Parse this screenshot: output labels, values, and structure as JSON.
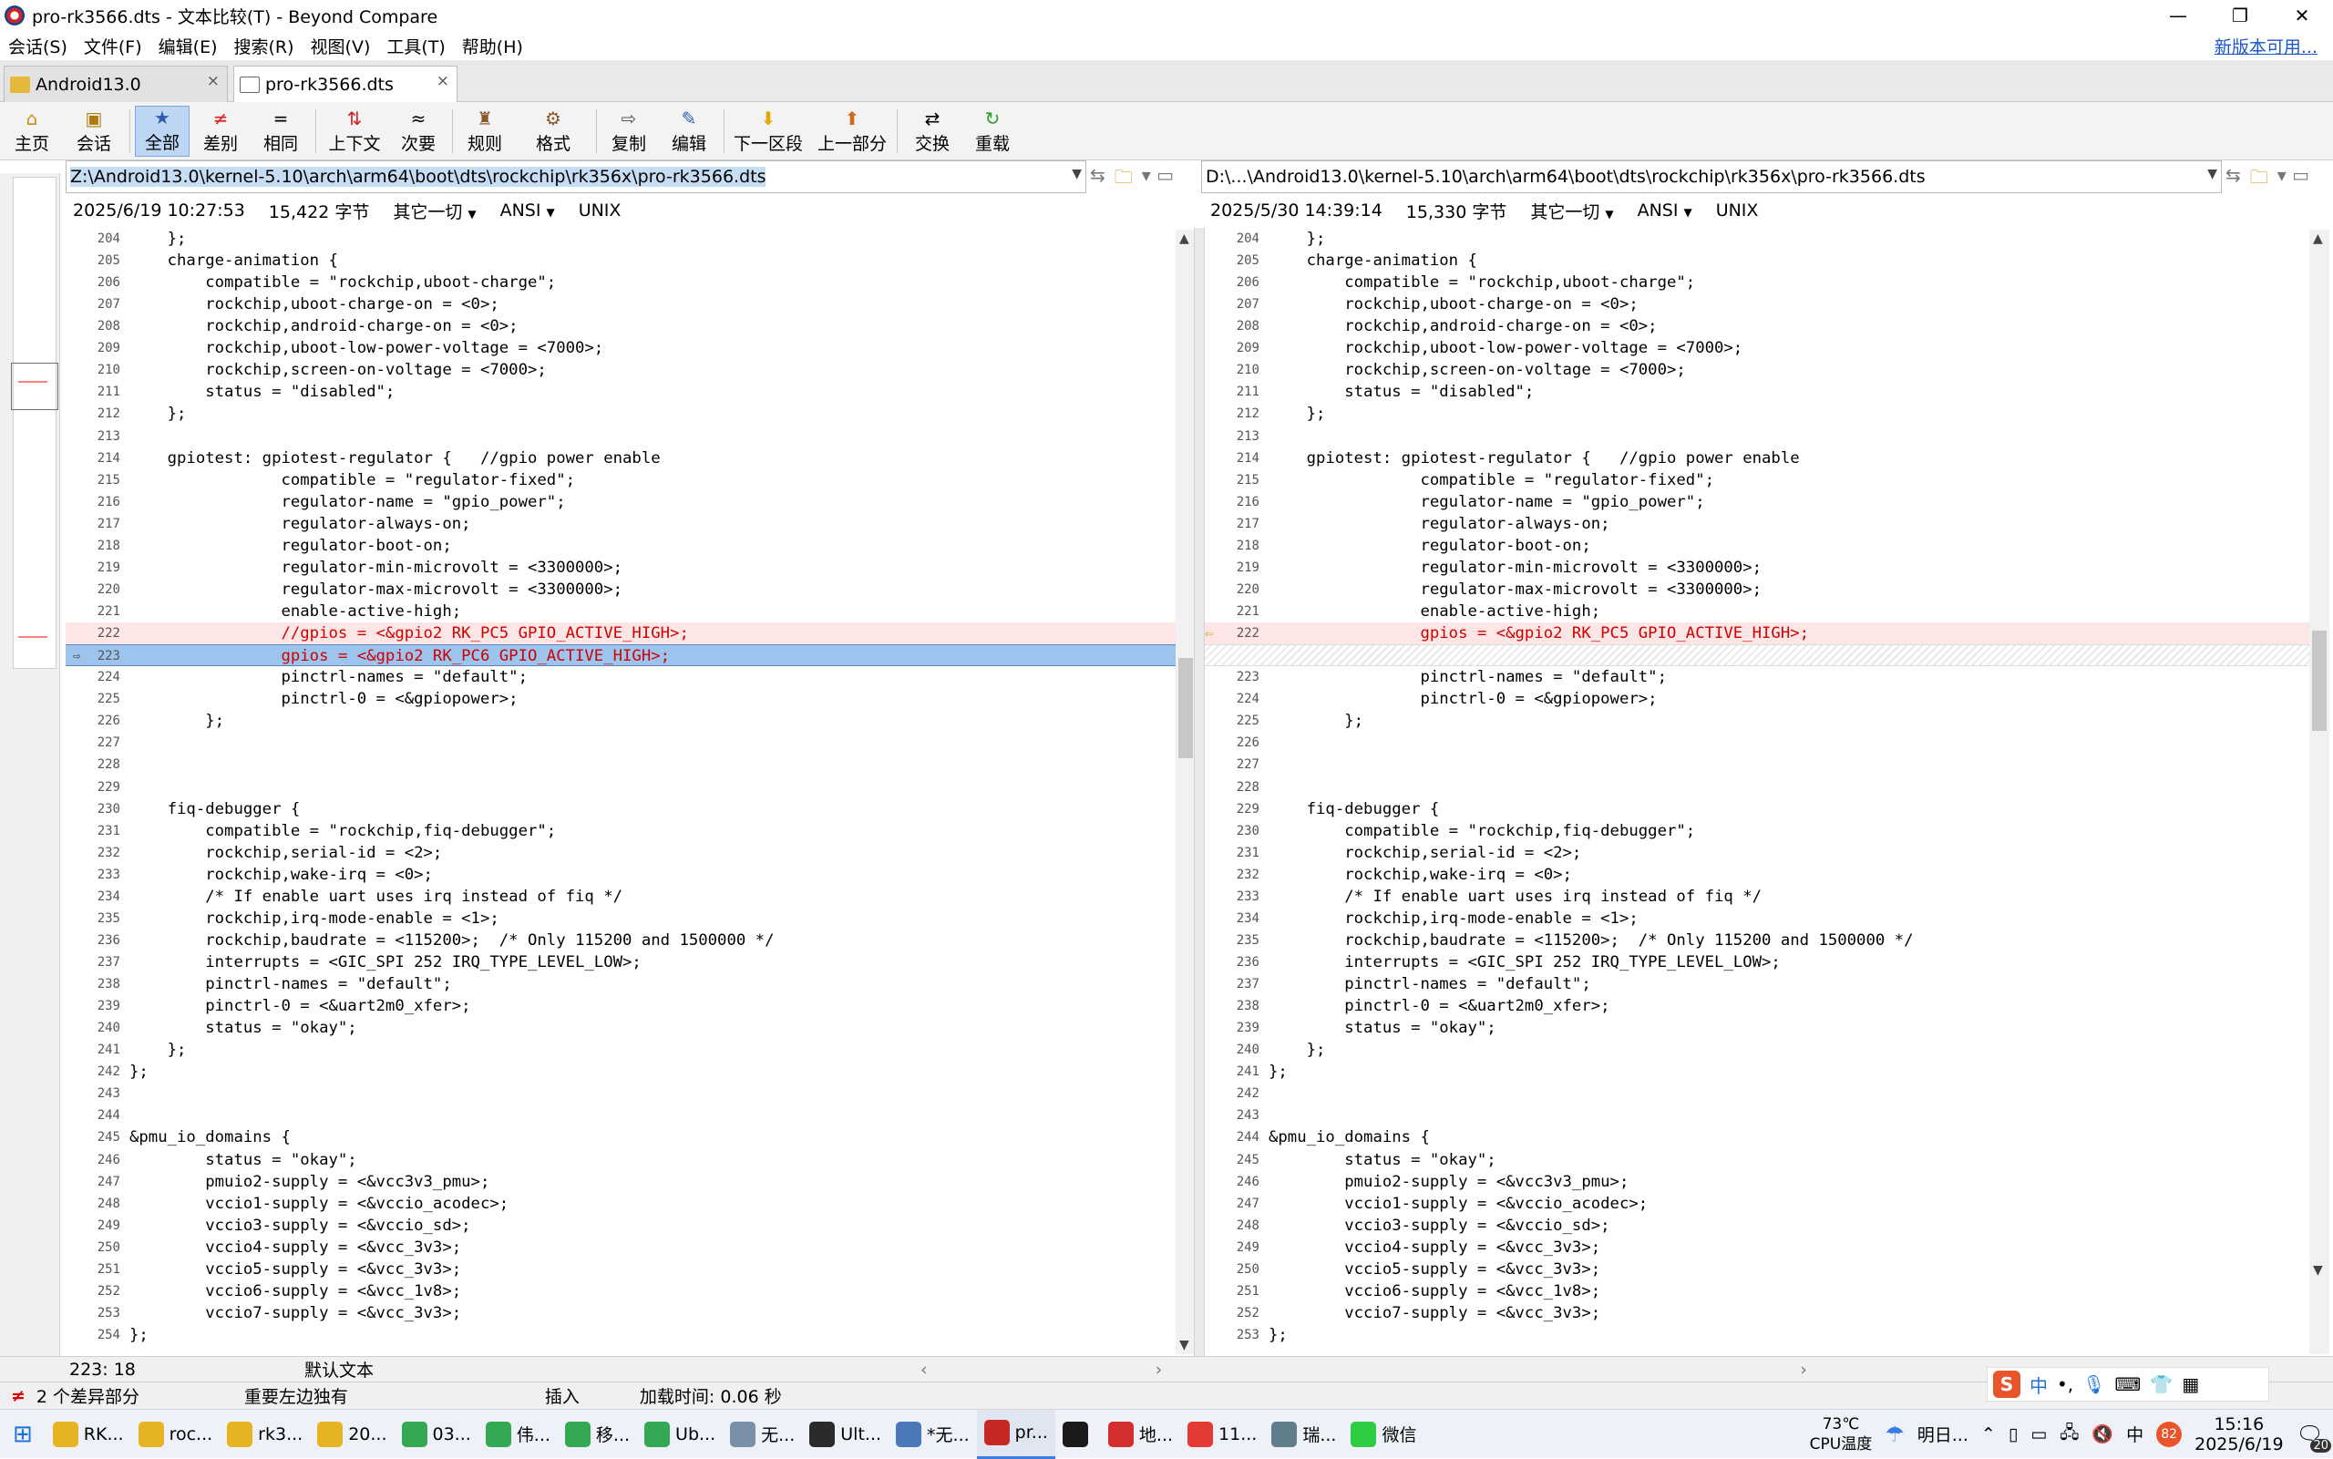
{
  "window": {
    "title": "pro-rk3566.dts - 文本比较(T) - Beyond Compare",
    "minimize": "—",
    "maximize": "❐",
    "close": "✕"
  },
  "menu": {
    "items": [
      "会话(S)",
      "文件(F)",
      "编辑(E)",
      "搜索(R)",
      "视图(V)",
      "工具(T)",
      "帮助(H)"
    ],
    "update_link": "新版本可用..."
  },
  "tabs": [
    {
      "label": "Android13.0",
      "close": "×"
    },
    {
      "label": "pro-rk3566.dts",
      "close": "×"
    }
  ],
  "toolbar": {
    "buttons": [
      {
        "label": "主页",
        "icon": "home-icon",
        "glyph": "⌂"
      },
      {
        "label": "会话",
        "icon": "session-icon",
        "glyph": "▣"
      },
      {
        "label": "全部",
        "icon": "all-icon",
        "glyph": "★"
      },
      {
        "label": "差别",
        "icon": "diffs-icon",
        "glyph": "≠"
      },
      {
        "label": "相同",
        "icon": "same-icon",
        "glyph": "="
      },
      {
        "label": "上下文",
        "icon": "context-icon",
        "glyph": "⇅"
      },
      {
        "label": "次要",
        "icon": "minor-icon",
        "glyph": "≈"
      },
      {
        "label": "规则",
        "icon": "rules-icon",
        "glyph": "♜"
      },
      {
        "label": "格式",
        "icon": "format-icon",
        "glyph": "⚙"
      },
      {
        "label": "复制",
        "icon": "copy-icon",
        "glyph": "⇨"
      },
      {
        "label": "编辑",
        "icon": "edit-icon",
        "glyph": "✎"
      },
      {
        "label": "下一区段",
        "icon": "next-section-icon",
        "glyph": "⬇"
      },
      {
        "label": "上一部分",
        "icon": "prev-section-icon",
        "glyph": "⬆"
      },
      {
        "label": "交换",
        "icon": "swap-icon",
        "glyph": "⇄"
      },
      {
        "label": "重载",
        "icon": "reload-icon",
        "glyph": "↻"
      }
    ]
  },
  "left": {
    "path": "Z:\\Android13.0\\kernel-5.10\\arch\\arm64\\boot\\dts\\rockchip\\rk356x\\pro-rk3566.dts",
    "date": "2025/6/19 10:27:53",
    "size": "15,422 字节",
    "filter": "其它一切",
    "encoding": "ANSI",
    "eol": "UNIX"
  },
  "right": {
    "path": "D:\\...\\Android13.0\\kernel-5.10\\arch\\arm64\\boot\\dts\\rockchip\\rk356x\\pro-rk3566.dts",
    "date": "2025/5/30 14:39:14",
    "size": "15,330 字节",
    "filter": "其它一切",
    "encoding": "ANSI",
    "eol": "UNIX"
  },
  "left_lines": [
    {
      "n": "204",
      "t": "    };"
    },
    {
      "n": "205",
      "t": "    charge-animation {"
    },
    {
      "n": "206",
      "t": "        compatible = \"rockchip,uboot-charge\";"
    },
    {
      "n": "207",
      "t": "        rockchip,uboot-charge-on = <0>;"
    },
    {
      "n": "208",
      "t": "        rockchip,android-charge-on = <0>;"
    },
    {
      "n": "209",
      "t": "        rockchip,uboot-low-power-voltage = <7000>;"
    },
    {
      "n": "210",
      "t": "        rockchip,screen-on-voltage = <7000>;"
    },
    {
      "n": "211",
      "t": "        status = \"disabled\";"
    },
    {
      "n": "212",
      "t": "    };"
    },
    {
      "n": "213",
      "t": ""
    },
    {
      "n": "214",
      "t": "    gpiotest: gpiotest-regulator {   //gpio power enable"
    },
    {
      "n": "215",
      "t": "                compatible = \"regulator-fixed\";"
    },
    {
      "n": "216",
      "t": "                regulator-name = \"gpio_power\";"
    },
    {
      "n": "217",
      "t": "                regulator-always-on;"
    },
    {
      "n": "218",
      "t": "                regulator-boot-on;"
    },
    {
      "n": "219",
      "t": "                regulator-min-microvolt = <3300000>;"
    },
    {
      "n": "220",
      "t": "                regulator-max-microvolt = <3300000>;"
    },
    {
      "n": "221",
      "t": "                enable-active-high;"
    },
    {
      "n": "222",
      "t": "                //gpios = <&gpio2 RK_PC5 GPIO_ACTIVE_HIGH>;",
      "k": "diff"
    },
    {
      "n": "223",
      "t": "                gpios = <&gpio2 RK_PC6 GPIO_ACTIVE_HIGH>;",
      "k": "cur"
    },
    {
      "n": "224",
      "t": "                pinctrl-names = \"default\";"
    },
    {
      "n": "225",
      "t": "                pinctrl-0 = <&gpiopower>;"
    },
    {
      "n": "226",
      "t": "        };"
    },
    {
      "n": "227",
      "t": ""
    },
    {
      "n": "228",
      "t": ""
    },
    {
      "n": "229",
      "t": ""
    },
    {
      "n": "230",
      "t": "    fiq-debugger {"
    },
    {
      "n": "231",
      "t": "        compatible = \"rockchip,fiq-debugger\";"
    },
    {
      "n": "232",
      "t": "        rockchip,serial-id = <2>;"
    },
    {
      "n": "233",
      "t": "        rockchip,wake-irq = <0>;"
    },
    {
      "n": "234",
      "t": "        /* If enable uart uses irq instead of fiq */"
    },
    {
      "n": "235",
      "t": "        rockchip,irq-mode-enable = <1>;"
    },
    {
      "n": "236",
      "t": "        rockchip,baudrate = <115200>;  /* Only 115200 and 1500000 */"
    },
    {
      "n": "237",
      "t": "        interrupts = <GIC_SPI 252 IRQ_TYPE_LEVEL_LOW>;"
    },
    {
      "n": "238",
      "t": "        pinctrl-names = \"default\";"
    },
    {
      "n": "239",
      "t": "        pinctrl-0 = <&uart2m0_xfer>;"
    },
    {
      "n": "240",
      "t": "        status = \"okay\";"
    },
    {
      "n": "241",
      "t": "    };"
    },
    {
      "n": "242",
      "t": "};"
    },
    {
      "n": "243",
      "t": ""
    },
    {
      "n": "244",
      "t": ""
    },
    {
      "n": "245",
      "t": "&pmu_io_domains {"
    },
    {
      "n": "246",
      "t": "        status = \"okay\";"
    },
    {
      "n": "247",
      "t": "        pmuio2-supply = <&vcc3v3_pmu>;"
    },
    {
      "n": "248",
      "t": "        vccio1-supply = <&vccio_acodec>;"
    },
    {
      "n": "249",
      "t": "        vccio3-supply = <&vccio_sd>;"
    },
    {
      "n": "250",
      "t": "        vccio4-supply = <&vcc_3v3>;"
    },
    {
      "n": "251",
      "t": "        vccio5-supply = <&vcc_3v3>;"
    },
    {
      "n": "252",
      "t": "        vccio6-supply = <&vcc_1v8>;"
    },
    {
      "n": "253",
      "t": "        vccio7-supply = <&vcc_3v3>;"
    },
    {
      "n": "254",
      "t": "};"
    }
  ],
  "right_lines": [
    {
      "n": "204",
      "t": "    };"
    },
    {
      "n": "205",
      "t": "    charge-animation {"
    },
    {
      "n": "206",
      "t": "        compatible = \"rockchip,uboot-charge\";"
    },
    {
      "n": "207",
      "t": "        rockchip,uboot-charge-on = <0>;"
    },
    {
      "n": "208",
      "t": "        rockchip,android-charge-on = <0>;"
    },
    {
      "n": "209",
      "t": "        rockchip,uboot-low-power-voltage = <7000>;"
    },
    {
      "n": "210",
      "t": "        rockchip,screen-on-voltage = <7000>;"
    },
    {
      "n": "211",
      "t": "        status = \"disabled\";"
    },
    {
      "n": "212",
      "t": "    };"
    },
    {
      "n": "213",
      "t": ""
    },
    {
      "n": "214",
      "t": "    gpiotest: gpiotest-regulator {   //gpio power enable"
    },
    {
      "n": "215",
      "t": "                compatible = \"regulator-fixed\";"
    },
    {
      "n": "216",
      "t": "                regulator-name = \"gpio_power\";"
    },
    {
      "n": "217",
      "t": "                regulator-always-on;"
    },
    {
      "n": "218",
      "t": "                regulator-boot-on;"
    },
    {
      "n": "219",
      "t": "                regulator-min-microvolt = <3300000>;"
    },
    {
      "n": "220",
      "t": "                regulator-max-microvolt = <3300000>;"
    },
    {
      "n": "221",
      "t": "                enable-active-high;"
    },
    {
      "n": "222",
      "t": "                gpios = <&gpio2 RK_PC5 GPIO_ACTIVE_HIGH>;",
      "k": "diff"
    },
    {
      "n": "",
      "t": "",
      "k": "blank"
    },
    {
      "n": "223",
      "t": "                pinctrl-names = \"default\";"
    },
    {
      "n": "224",
      "t": "                pinctrl-0 = <&gpiopower>;"
    },
    {
      "n": "225",
      "t": "        };"
    },
    {
      "n": "226",
      "t": ""
    },
    {
      "n": "227",
      "t": ""
    },
    {
      "n": "228",
      "t": ""
    },
    {
      "n": "229",
      "t": "    fiq-debugger {"
    },
    {
      "n": "230",
      "t": "        compatible = \"rockchip,fiq-debugger\";"
    },
    {
      "n": "231",
      "t": "        rockchip,serial-id = <2>;"
    },
    {
      "n": "232",
      "t": "        rockchip,wake-irq = <0>;"
    },
    {
      "n": "233",
      "t": "        /* If enable uart uses irq instead of fiq */"
    },
    {
      "n": "234",
      "t": "        rockchip,irq-mode-enable = <1>;"
    },
    {
      "n": "235",
      "t": "        rockchip,baudrate = <115200>;  /* Only 115200 and 1500000 */"
    },
    {
      "n": "236",
      "t": "        interrupts = <GIC_SPI 252 IRQ_TYPE_LEVEL_LOW>;"
    },
    {
      "n": "237",
      "t": "        pinctrl-names = \"default\";"
    },
    {
      "n": "238",
      "t": "        pinctrl-0 = <&uart2m0_xfer>;"
    },
    {
      "n": "239",
      "t": "        status = \"okay\";"
    },
    {
      "n": "240",
      "t": "    };"
    },
    {
      "n": "241",
      "t": "};"
    },
    {
      "n": "242",
      "t": ""
    },
    {
      "n": "243",
      "t": ""
    },
    {
      "n": "244",
      "t": "&pmu_io_domains {"
    },
    {
      "n": "245",
      "t": "        status = \"okay\";"
    },
    {
      "n": "246",
      "t": "        pmuio2-supply = <&vcc3v3_pmu>;"
    },
    {
      "n": "247",
      "t": "        vccio1-supply = <&vccio_acodec>;"
    },
    {
      "n": "248",
      "t": "        vccio3-supply = <&vccio_sd>;"
    },
    {
      "n": "249",
      "t": "        vccio4-supply = <&vcc_3v3>;"
    },
    {
      "n": "250",
      "t": "        vccio5-supply = <&vcc_3v3>;"
    },
    {
      "n": "251",
      "t": "        vccio6-supply = <&vcc_1v8>;"
    },
    {
      "n": "252",
      "t": "        vccio7-supply = <&vcc_3v3>;"
    },
    {
      "n": "253",
      "t": "};"
    }
  ],
  "status": {
    "position": "223: 18",
    "text_mode": "默认文本",
    "diff_count": "2 个差异部分",
    "importance": "重要左边独有",
    "insert_mode": "插入",
    "load_time": "加载时间: 0.06 秒"
  },
  "taskbar": {
    "items": [
      {
        "label": "RK...",
        "color": "#e6b422"
      },
      {
        "label": "roc...",
        "color": "#e6b422"
      },
      {
        "label": "rk3...",
        "color": "#e6b422"
      },
      {
        "label": "20...",
        "color": "#e6b422"
      },
      {
        "label": "03...",
        "color": "#34a853"
      },
      {
        "label": "伟...",
        "color": "#34a853"
      },
      {
        "label": "移...",
        "color": "#34a853"
      },
      {
        "label": "Ub...",
        "color": "#34a853"
      },
      {
        "label": "无...",
        "color": "#7a8fa8"
      },
      {
        "label": "Ult...",
        "color": "#2b2b2b"
      },
      {
        "label": "*无...",
        "color": "#4a78b8"
      },
      {
        "label": "pr...",
        "color": "#c62828"
      },
      {
        "label": "",
        "color": "#1a1a1a"
      },
      {
        "label": "地...",
        "color": "#d32f2f"
      },
      {
        "label": "11...",
        "color": "#e53935"
      },
      {
        "label": "瑞...",
        "color": "#607d8b"
      },
      {
        "label": "微信",
        "color": "#2ecc40"
      }
    ],
    "weather_temp": "73℃",
    "weather_label": "CPU温度",
    "weather2": "明日...",
    "badge": "82",
    "time": "15:16",
    "date": "2025/6/19",
    "notifications": "20",
    "ime_lang": "中"
  }
}
